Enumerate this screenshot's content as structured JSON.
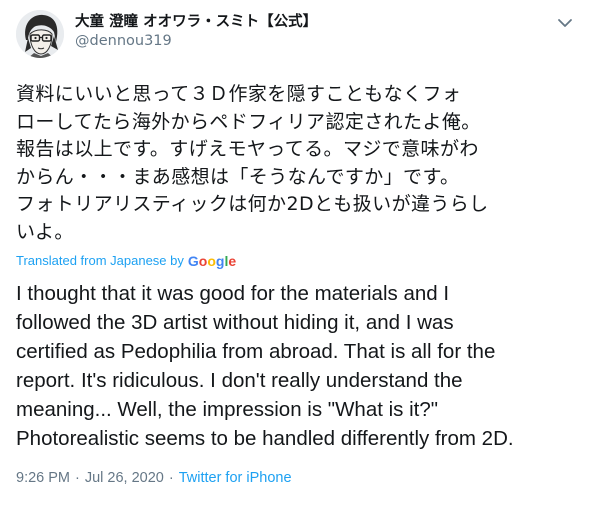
{
  "author": {
    "display_name": "大童 澄瞳 オオワラ・スミト【公式】",
    "handle": "@dennou319"
  },
  "tweet": {
    "original_text": "資料にいいと思って３Ｄ作家を隠すこともなくフォ\nローしてたら海外からペドフィリア認定されたよ俺。\n報告は以上です。すげえモヤってる。マジで意味がわ\nからん・・・まあ感想は「そうなんですか」です。\nフォトリアリスティックは何か2Dとも扱いが違うらし\nいよ。",
    "translated_label": "Translated from Japanese by",
    "translator": "Google",
    "translated_text": "I thought that it was good for the materials and I\nfollowed the 3D artist without hiding it, and I was\ncertified as Pedophilia from abroad. That is all for the\nreport. It's ridiculous. I don't really understand the\nmeaning... Well, the impression is \"What is it?\"\nPhotorealistic seems to be handled differently from 2D.",
    "time": "9:26 PM",
    "separator": "·",
    "date": "Jul 26, 2020",
    "source": "Twitter for iPhone"
  },
  "icons": {
    "menu": "chevron-down-icon",
    "avatar": "avatar"
  },
  "colors": {
    "link": "#1da1f2",
    "muted": "#657786",
    "text": "#14171a",
    "google_blue": "#4285f4",
    "google_red": "#ea4335",
    "google_yellow": "#fbbc05",
    "google_green": "#34a853"
  }
}
